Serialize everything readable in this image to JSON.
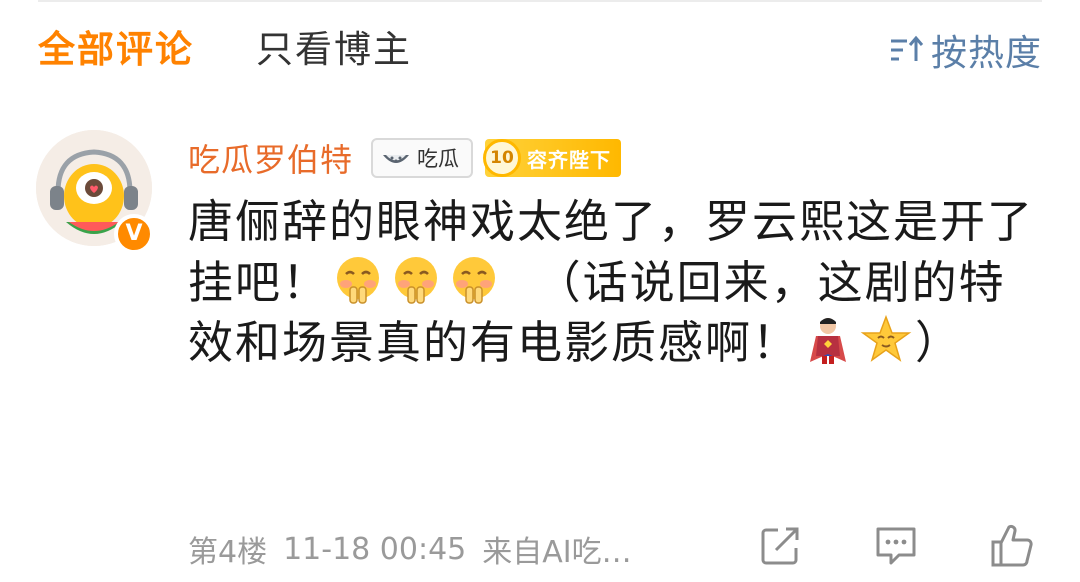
{
  "tabs": {
    "all_comments": "全部评论",
    "author_only": "只看博主",
    "sort_label": "按热度"
  },
  "comment": {
    "username": "吃瓜罗伯特",
    "fan_badge_label": "吃瓜",
    "level_number": "10",
    "level_title": "容齐陛下",
    "verified_mark": "V",
    "text_part1": "唐俪辞的眼神戏太绝了，罗云熙这是开了挂吧！",
    "text_part2": "（话说回来，这剧的特效和场景真的有电影质感啊！",
    "text_part3": "）",
    "emojis": [
      "pleading-hands-emoji",
      "pleading-hands-emoji",
      "pleading-hands-emoji",
      "superman-emoji",
      "star-face-emoji"
    ],
    "floor": "第4楼",
    "timestamp": "11-18 00:45",
    "source": "来自AI吃…"
  },
  "colors": {
    "accent_orange": "#ff8200",
    "username_orange": "#e86b2a",
    "link_blue": "#5b7fa8",
    "meta_gray": "#9a9a9a"
  },
  "icons": {
    "sort": "sort-icon",
    "repost": "repost-icon",
    "comment": "comment-icon",
    "like": "like-icon"
  }
}
